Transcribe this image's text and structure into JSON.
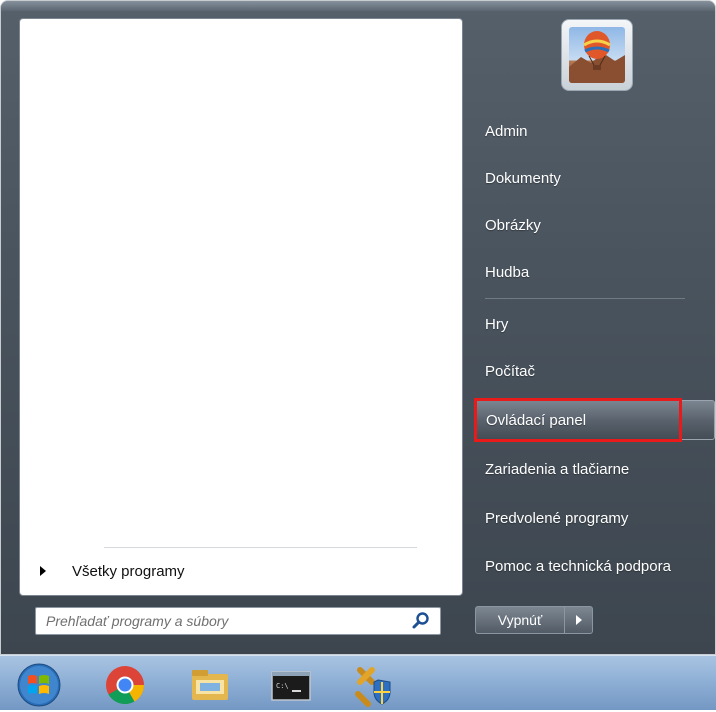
{
  "left_pane": {
    "all_programs_label": "Všetky programy",
    "search": {
      "placeholder": "Prehľadať programy a súbory",
      "value": ""
    }
  },
  "right_pane": {
    "items": [
      {
        "id": "admin",
        "label": "Admin"
      },
      {
        "id": "documents",
        "label": "Dokumenty"
      },
      {
        "id": "pictures",
        "label": "Obrázky"
      },
      {
        "id": "music",
        "label": "Hudba"
      },
      {
        "id": "games",
        "label": "Hry"
      },
      {
        "id": "computer",
        "label": "Počítač"
      },
      {
        "id": "control-panel",
        "label": "Ovládací panel"
      },
      {
        "id": "devices-printers",
        "label": "Zariadenia a tlačiarne"
      },
      {
        "id": "default-programs",
        "label": "Predvolené programy"
      },
      {
        "id": "help-support",
        "label": "Pomoc a technická podpora"
      }
    ],
    "highlighted": "control-panel"
  },
  "shutdown": {
    "label": "Vypnúť"
  },
  "taskbar": {
    "icons": [
      "windows-start-orb-icon",
      "chrome-icon",
      "file-explorer-icon",
      "command-prompt-icon",
      "tools-shield-icon"
    ]
  },
  "colors": {
    "highlight_box": "#e81a1a",
    "menu_bg": "#4a545e",
    "taskbar_bg": "#8fb0d6"
  }
}
